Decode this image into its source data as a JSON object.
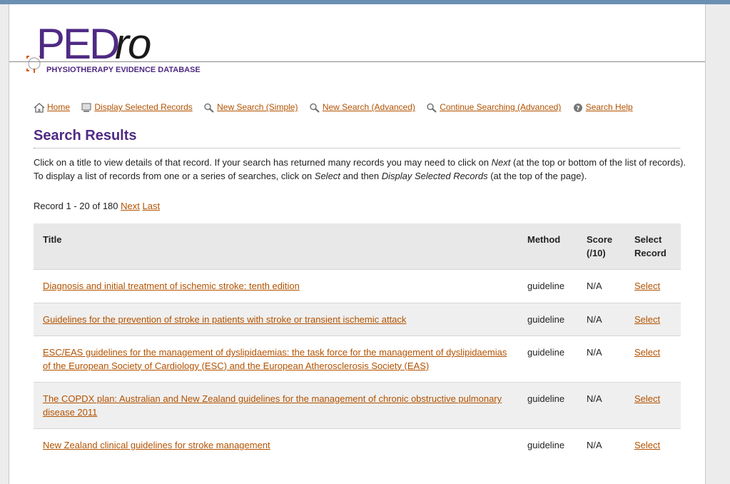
{
  "logo": {
    "main": "PED",
    "italic": "ro",
    "subtitle": "PHYSIOTHERAPY EVIDENCE DATABASE"
  },
  "nav": [
    {
      "label": "Home",
      "icon": "home-icon"
    },
    {
      "label": "Display Selected Records",
      "icon": "monitor-icon"
    },
    {
      "label": "New Search (Simple)",
      "icon": "magnifier-icon"
    },
    {
      "label": "New Search (Advanced)",
      "icon": "magnifier-icon"
    },
    {
      "label": "Continue Searching (Advanced)",
      "icon": "magnifier-icon"
    },
    {
      "label": "Search Help",
      "icon": "help-icon"
    }
  ],
  "page_title": "Search Results",
  "intro": {
    "p1": "Click on a title to view details of that record. If your search has returned many records you may need to click on ",
    "next_word": "Next",
    "p2": " (at the top or bottom of the list of records). To display a list of records from one or a series of searches, click on ",
    "select_word": "Select",
    "p3": " and then ",
    "display_word": "Display Selected Records",
    "p4": " (at the top of the page)."
  },
  "record_info": {
    "text": "Record 1 - 20 of 180",
    "next": "Next",
    "last": "Last"
  },
  "table": {
    "headers": {
      "title": "Title",
      "method": "Method",
      "score": "Score (/10)",
      "select": "Select Record"
    },
    "rows": [
      {
        "title": "Diagnosis and initial treatment of ischemic stroke: tenth edition",
        "method": "guideline",
        "score": "N/A",
        "select": "Select"
      },
      {
        "title": "Guidelines for the prevention of stroke in patients with stroke or transient ischemic attack",
        "method": "guideline",
        "score": "N/A",
        "select": "Select"
      },
      {
        "title": "ESC/EAS guidelines for the management of dyslipidaemias: the task force for the management of dyslipidaemias of the European Society of Cardiology (ESC) and the European Atherosclerosis Society (EAS)",
        "method": "guideline",
        "score": "N/A",
        "select": "Select"
      },
      {
        "title": "The COPDX plan: Australian and New Zealand guidelines for the management of chronic obstructive pulmonary disease 2011",
        "method": "guideline",
        "score": "N/A",
        "select": "Select"
      },
      {
        "title": "New Zealand clinical guidelines for stroke management",
        "method": "guideline",
        "score": "N/A",
        "select": "Select"
      }
    ]
  },
  "colors": {
    "brand_purple": "#4f2a84",
    "link_orange": "#b35200",
    "header_gray": "#e8e8e8"
  }
}
